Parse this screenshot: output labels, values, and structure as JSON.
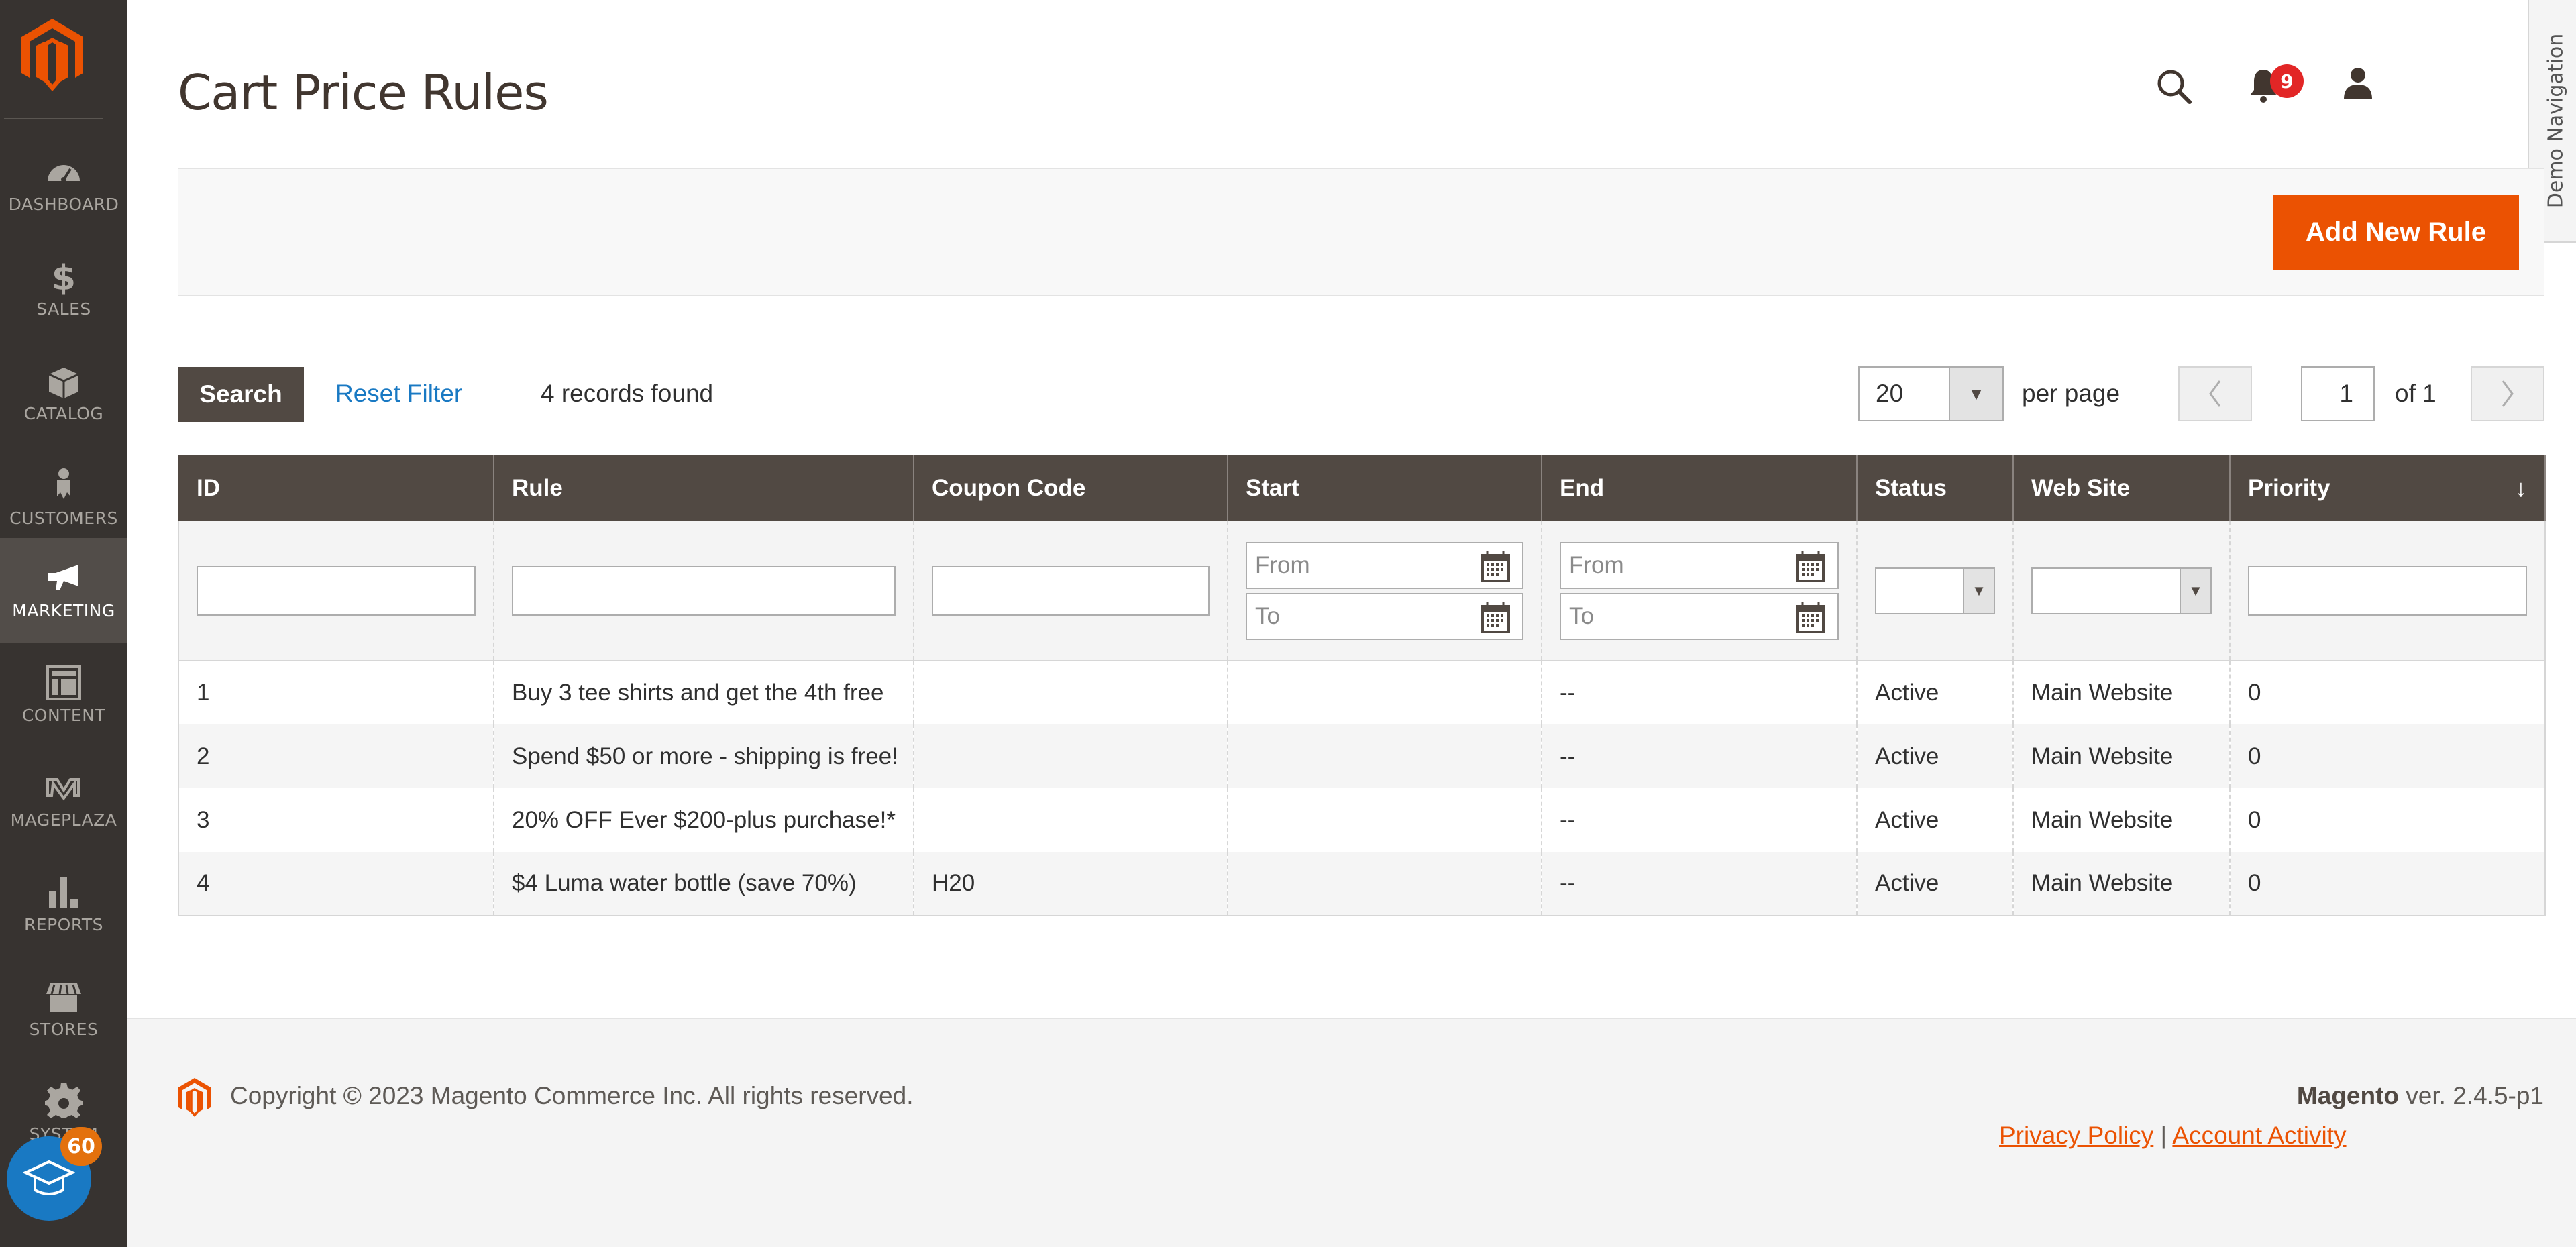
{
  "app": {
    "brand_color": "#eb5202",
    "sidebar_bg": "#373330",
    "header_bg": "#514943",
    "link_color": "#1979c3"
  },
  "sidebar": {
    "logo": "magento-logo",
    "items": [
      {
        "label": "DASHBOARD",
        "icon": "dashboard-icon",
        "active": false
      },
      {
        "label": "SALES",
        "icon": "dollar-icon",
        "active": false
      },
      {
        "label": "CATALOG",
        "icon": "box-icon",
        "active": false
      },
      {
        "label": "CUSTOMERS",
        "icon": "person-icon",
        "active": false
      },
      {
        "label": "MARKETING",
        "icon": "megaphone-icon",
        "active": true
      },
      {
        "label": "CONTENT",
        "icon": "layout-icon",
        "active": false
      },
      {
        "label": "MAGEPLAZA",
        "icon": "mageplaza-icon",
        "active": false
      },
      {
        "label": "REPORTS",
        "icon": "bar-chart-icon",
        "active": false
      },
      {
        "label": "STORES",
        "icon": "store-icon",
        "active": false
      },
      {
        "label": "SYSTEM",
        "icon": "gear-icon",
        "active": false
      }
    ],
    "help_badge": "60"
  },
  "header": {
    "title": "Cart Price Rules",
    "notifications_count": "9",
    "demo_navigation": "Demo Navigation"
  },
  "actions": {
    "add_new_rule": "Add New Rule"
  },
  "toolbar": {
    "search_label": "Search",
    "reset_filter_label": "Reset Filter",
    "records_found": "4 records found",
    "per_page_value": "20",
    "per_page_label": "per page",
    "current_page": "1",
    "page_of": "of 1"
  },
  "grid": {
    "columns": [
      "ID",
      "Rule",
      "Coupon Code",
      "Start",
      "End",
      "Status",
      "Web Site",
      "Priority"
    ],
    "sort_indicator": "↓",
    "filters": {
      "date_from_placeholder": "From",
      "date_to_placeholder": "To"
    },
    "rows": [
      {
        "id": "1",
        "rule": "Buy 3 tee shirts and get the 4th free",
        "coupon": "",
        "start": "",
        "end": "--",
        "status": "Active",
        "website": "Main Website",
        "priority": "0"
      },
      {
        "id": "2",
        "rule": "Spend $50 or more - shipping is free!",
        "coupon": "",
        "start": "",
        "end": "--",
        "status": "Active",
        "website": "Main Website",
        "priority": "0"
      },
      {
        "id": "3",
        "rule": "20% OFF Ever $200-plus purchase!*",
        "coupon": "",
        "start": "",
        "end": "--",
        "status": "Active",
        "website": "Main Website",
        "priority": "0"
      },
      {
        "id": "4",
        "rule": "$4 Luma water bottle (save 70%)",
        "coupon": "H20",
        "start": "",
        "end": "--",
        "status": "Active",
        "website": "Main Website",
        "priority": "0"
      }
    ]
  },
  "footer": {
    "copyright": "Copyright © 2023 Magento Commerce Inc. All rights reserved.",
    "brand": "Magento",
    "version": " ver. 2.4.5-p1",
    "privacy_policy": "Privacy Policy",
    "separator": " | ",
    "account_activity": "Account Activity"
  }
}
